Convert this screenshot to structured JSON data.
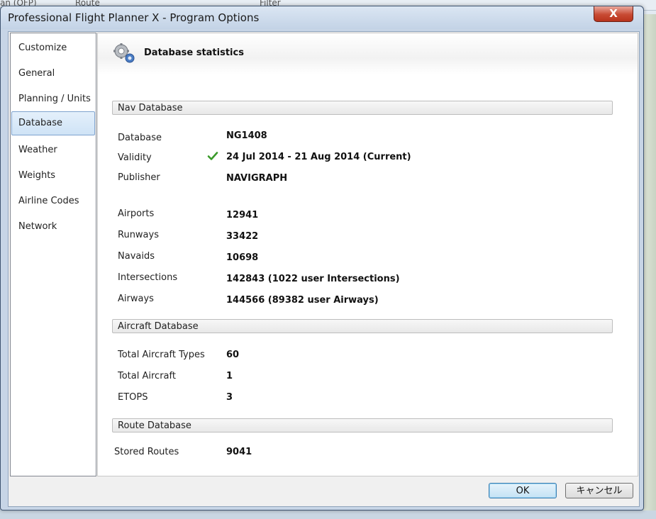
{
  "background": {
    "tabs": [
      "an (OFP)",
      "Route",
      "Filter"
    ]
  },
  "window": {
    "title": "Professional Flight Planner X - Program Options",
    "close_glyph": "X"
  },
  "nav": {
    "items": [
      {
        "label": "Customize"
      },
      {
        "label": "General"
      },
      {
        "label": "Planning / Units"
      },
      {
        "label": "Database",
        "selected": true
      },
      {
        "label": "Weather"
      },
      {
        "label": "Weights"
      },
      {
        "label": "Airline Codes"
      },
      {
        "label": "Network"
      }
    ]
  },
  "page": {
    "title": "Database statistics",
    "icon": "gears-icon"
  },
  "nav_db": {
    "header": "Nav Database",
    "rows": [
      {
        "label": "Database",
        "value": "NG1408"
      },
      {
        "label": "Validity",
        "value": "24 Jul 2014 - 21 Aug 2014 (Current)",
        "status_icon": "green-check-icon"
      },
      {
        "label": "Publisher",
        "value": "NAVIGRAPH"
      },
      {
        "label": "Airports",
        "value": "12941"
      },
      {
        "label": "Runways",
        "value": "33422"
      },
      {
        "label": "Navaids",
        "value": "10698"
      },
      {
        "label": "Intersections",
        "value": "142843 (1022 user Intersections)"
      },
      {
        "label": "Airways",
        "value": "144566 (89382 user Airways)"
      }
    ]
  },
  "aircraft_db": {
    "header": "Aircraft Database",
    "rows": [
      {
        "label": "Total Aircraft Types",
        "value": "60"
      },
      {
        "label": "Total Aircraft",
        "value": "1"
      },
      {
        "label": "ETOPS",
        "value": "3"
      }
    ]
  },
  "route_db": {
    "header": "Route Database",
    "rows": [
      {
        "label": "Stored Routes",
        "value": "9041"
      }
    ]
  },
  "buttons": {
    "ok": "OK",
    "cancel": "キャンセル"
  },
  "colors": {
    "accent_check": "#3a9a2a",
    "selected_bg": "#cfe3f6",
    "close_red": "#c84a33"
  }
}
